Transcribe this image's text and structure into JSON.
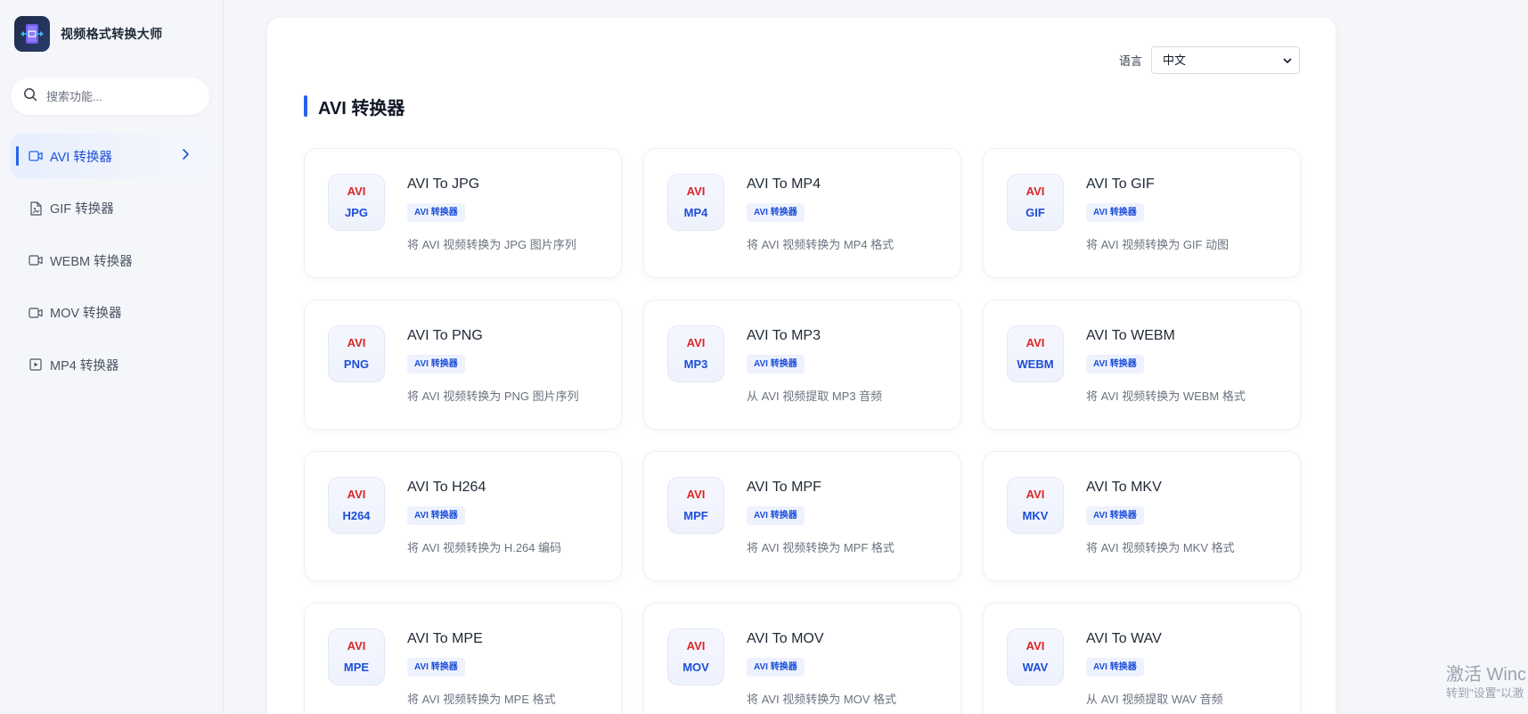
{
  "app": {
    "title": "视频格式转换大师"
  },
  "search": {
    "placeholder": "搜索功能..."
  },
  "sidebar": {
    "items": [
      {
        "label": "AVI 转换器",
        "icon": "video-icon",
        "active": true
      },
      {
        "label": "GIF 转换器",
        "icon": "file-image-icon",
        "active": false
      },
      {
        "label": "WEBM 转换器",
        "icon": "video-icon",
        "active": false
      },
      {
        "label": "MOV 转换器",
        "icon": "video-icon",
        "active": false
      },
      {
        "label": "MP4 转换器",
        "icon": "play-square-icon",
        "active": false
      }
    ]
  },
  "language": {
    "label": "语言",
    "selected": "中文"
  },
  "section": {
    "title": "AVI 转换器"
  },
  "cards": [
    {
      "from": "AVI",
      "to": "JPG",
      "title": "AVI To JPG",
      "tag": "AVI 转换器",
      "desc": "将 AVI 视频转换为 JPG 图片序列"
    },
    {
      "from": "AVI",
      "to": "MP4",
      "title": "AVI To MP4",
      "tag": "AVI 转换器",
      "desc": "将 AVI 视频转换为 MP4 格式"
    },
    {
      "from": "AVI",
      "to": "GIF",
      "title": "AVI To GIF",
      "tag": "AVI 转换器",
      "desc": "将 AVI 视频转换为 GIF 动图"
    },
    {
      "from": "AVI",
      "to": "PNG",
      "title": "AVI To PNG",
      "tag": "AVI 转换器",
      "desc": "将 AVI 视频转换为 PNG 图片序列"
    },
    {
      "from": "AVI",
      "to": "MP3",
      "title": "AVI To MP3",
      "tag": "AVI 转换器",
      "desc": "从 AVI 视频提取 MP3 音频"
    },
    {
      "from": "AVI",
      "to": "WEBM",
      "title": "AVI To WEBM",
      "tag": "AVI 转换器",
      "desc": "将 AVI 视频转换为 WEBM 格式"
    },
    {
      "from": "AVI",
      "to": "H264",
      "title": "AVI To H264",
      "tag": "AVI 转换器",
      "desc": "将 AVI 视频转换为 H.264 编码"
    },
    {
      "from": "AVI",
      "to": "MPF",
      "title": "AVI To MPF",
      "tag": "AVI 转换器",
      "desc": "将 AVI 视频转换为 MPF 格式"
    },
    {
      "from": "AVI",
      "to": "MKV",
      "title": "AVI To MKV",
      "tag": "AVI 转换器",
      "desc": "将 AVI 视频转换为 MKV 格式"
    },
    {
      "from": "AVI",
      "to": "MPE",
      "title": "AVI To MPE",
      "tag": "AVI 转换器",
      "desc": "将 AVI 视频转换为 MPE 格式"
    },
    {
      "from": "AVI",
      "to": "MOV",
      "title": "AVI To MOV",
      "tag": "AVI 转换器",
      "desc": "将 AVI 视频转换为 MOV 格式"
    },
    {
      "from": "AVI",
      "to": "WAV",
      "title": "AVI To WAV",
      "tag": "AVI 转换器",
      "desc": "从 AVI 视频提取 WAV 音频"
    }
  ],
  "watermark": {
    "line1": "激活 Winc",
    "line2": "转到\"设置\"以激"
  },
  "colors": {
    "accent": "#2563eb",
    "from_format": "#dc2626",
    "to_format": "#1d4ed8",
    "background": "#f4f6fa"
  }
}
